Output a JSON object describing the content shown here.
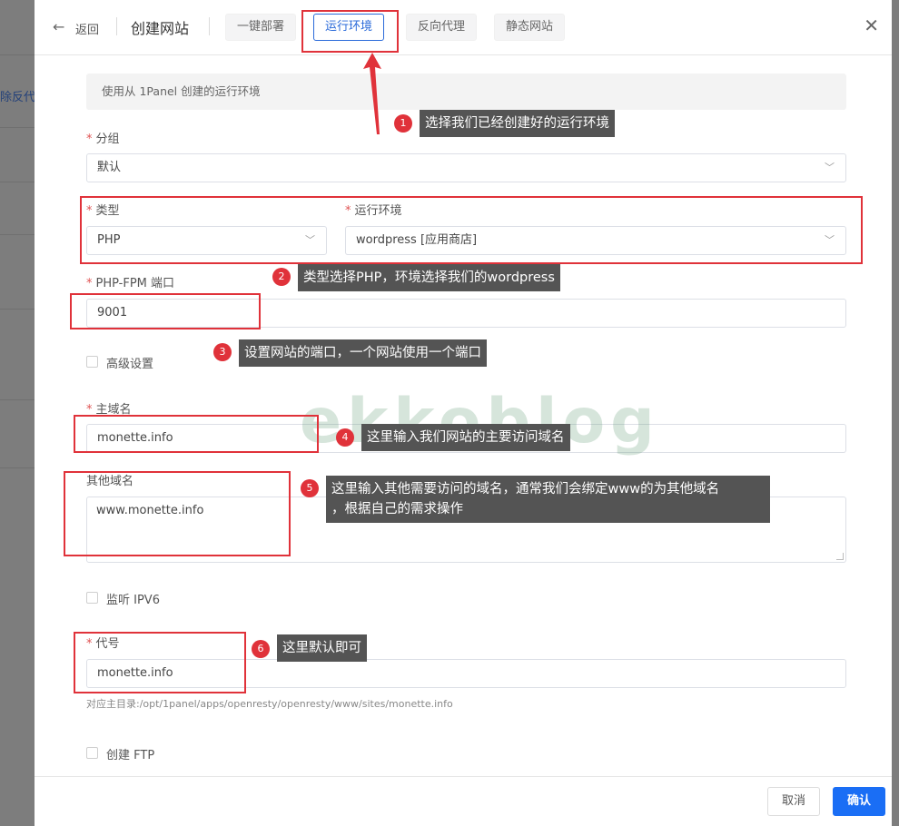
{
  "background": {
    "partial_text": "除反代"
  },
  "header": {
    "back_label": "返回",
    "title": "创建网站",
    "tabs": [
      {
        "label": "一键部署",
        "active": false
      },
      {
        "label": "运行环境",
        "active": true
      },
      {
        "label": "反向代理",
        "active": false
      },
      {
        "label": "静态网站",
        "active": false
      }
    ]
  },
  "form": {
    "notice": "使用从 1Panel 创建的运行环境",
    "group": {
      "label": "分组",
      "value": "默认"
    },
    "type": {
      "label": "类型",
      "value": "PHP"
    },
    "runtime": {
      "label": "运行环境",
      "value": "wordpress [应用商店]"
    },
    "fpm_port": {
      "label": "PHP-FPM 端口",
      "value": "9001"
    },
    "advanced": {
      "label": "高级设置"
    },
    "primary_domain": {
      "label": "主域名",
      "value": "monette.info"
    },
    "other_domains": {
      "label": "其他域名",
      "value": "www.monette.info"
    },
    "ipv6": {
      "label": "监听 IPV6"
    },
    "alias": {
      "label": "代号",
      "value": "monette.info",
      "hint": "对应主目录:/opt/1panel/apps/openresty/openresty/www/sites/monette.info"
    },
    "ftp": {
      "label": "创建 FTP"
    }
  },
  "footer": {
    "cancel_label": "取消",
    "confirm_label": "确认"
  },
  "annotations": [
    {
      "num": "1",
      "text": "选择我们已经创建好的运行环境"
    },
    {
      "num": "2",
      "text": "类型选择PHP，环境选择我们的wordpress"
    },
    {
      "num": "3",
      "text": "设置网站的端口，一个网站使用一个端口"
    },
    {
      "num": "4",
      "text": "这里输入我们网站的主要访问域名"
    },
    {
      "num": "5",
      "text": "这里输入其他需要访问的域名，通常我们会绑定www的为其他域名",
      "text2": "，根据自己的需求操作"
    },
    {
      "num": "6",
      "text": "这里默认即可"
    }
  ],
  "watermark": "ekkoblog",
  "colors": {
    "accent": "#1a6ef5",
    "annotation_red": "#e0323a",
    "callout_bg": "#545454"
  }
}
